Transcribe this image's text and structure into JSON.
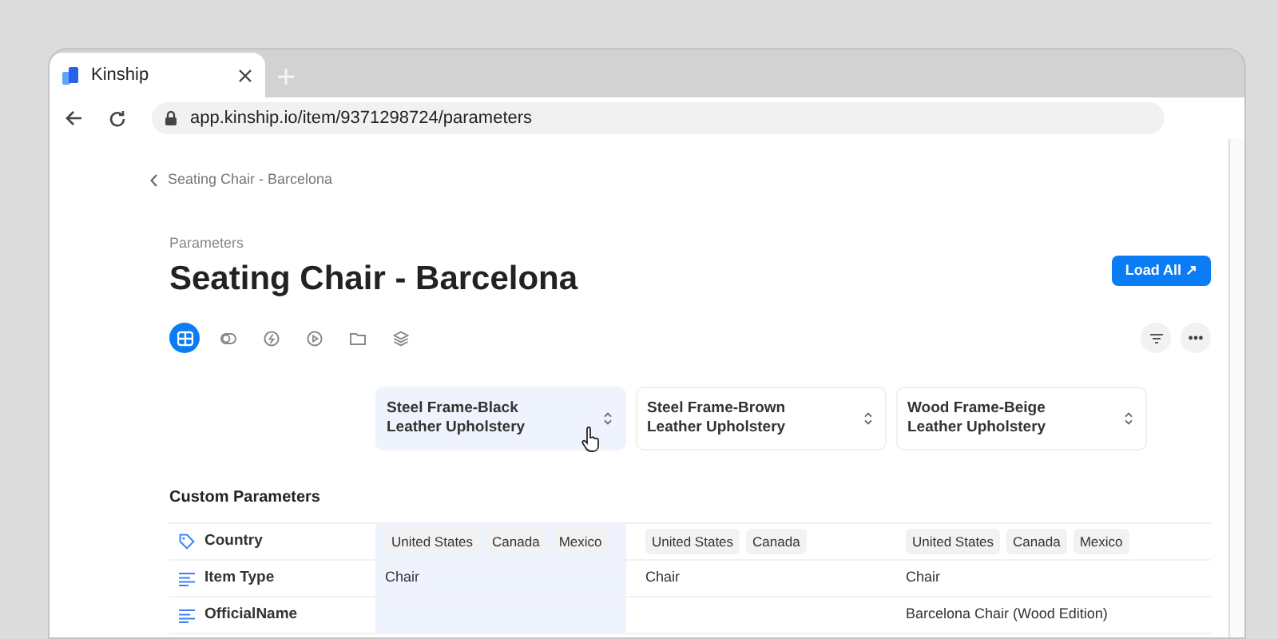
{
  "browser": {
    "tab_title": "Kinship",
    "url": "app.kinship.io/item/9371298724/parameters"
  },
  "breadcrumb": "Seating Chair - Barcelona",
  "header": {
    "subtitle": "Parameters",
    "title": "Seating Chair - Barcelona",
    "load_button": "Load All ↗"
  },
  "view_tabs": [
    {
      "kind": "table",
      "selected": true
    },
    {
      "kind": "toggle",
      "selected": false
    },
    {
      "kind": "bolt",
      "selected": false
    },
    {
      "kind": "play",
      "selected": false
    },
    {
      "kind": "folder",
      "selected": false
    },
    {
      "kind": "layers",
      "selected": false
    }
  ],
  "variants": [
    {
      "label": "Steel Frame-Black Leather Upholstery",
      "selected": true
    },
    {
      "label": "Steel Frame-Brown Leather Upholstery",
      "selected": false
    },
    {
      "label": "Wood Frame-Beige Leather Upholstery",
      "selected": false
    }
  ],
  "section_title": "Custom Parameters",
  "rows": [
    {
      "kind": "tag",
      "label": "Country",
      "cells": [
        {
          "kind": "tags",
          "tags": [
            "United States",
            "Canada",
            "Mexico"
          ]
        },
        {
          "kind": "tags",
          "tags": [
            "United States",
            "Canada"
          ]
        },
        {
          "kind": "tags",
          "tags": [
            "United States",
            "Canada",
            "Mexico"
          ]
        }
      ]
    },
    {
      "kind": "text",
      "label": "Item Type",
      "cells": [
        {
          "kind": "text",
          "text": "Chair"
        },
        {
          "kind": "text",
          "text": "Chair"
        },
        {
          "kind": "text",
          "text": "Chair"
        }
      ]
    },
    {
      "kind": "text",
      "label": "OfficialName",
      "cells": [
        {
          "kind": "empty"
        },
        {
          "kind": "empty"
        },
        {
          "kind": "text",
          "text": "Barcelona Chair (Wood Edition)"
        }
      ]
    }
  ]
}
